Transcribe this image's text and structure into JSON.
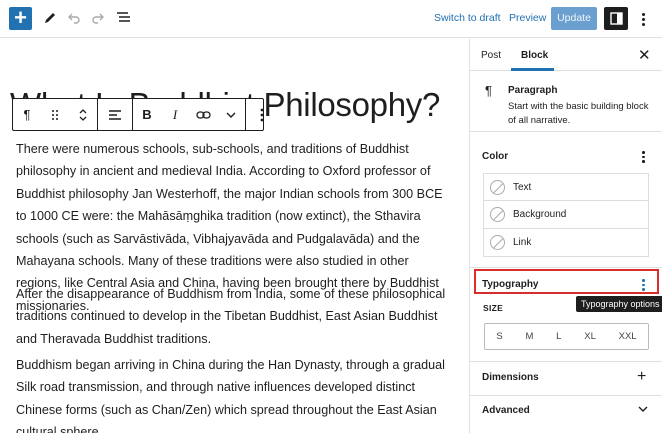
{
  "topbar": {
    "inserter_label": "+",
    "switch_to_draft": "Switch to draft",
    "preview": "Preview",
    "update": "Update"
  },
  "editor": {
    "title": "What Is Buddhist Philosophy?",
    "paragraphs": [
      "There were numerous schools, sub-schools, and traditions of Buddhist philosophy in ancient and medieval India. According to Oxford professor of Buddhist philosophy Jan Westerhoff, the major Indian schools from 300 BCE to 1000 CE were: the Mahāsāṃghika tradition (now extinct), the Sthavira schools (such as Sarvāstivāda, Vibhajyavāda and Pudgalavāda) and the Mahayana schools. Many of these traditions were also studied in other regions, like Central Asia and China, having been brought there by Buddhist missionaries.",
      "After the disappearance of Buddhism from India, some of these philosophical traditions continued to develop in the Tibetan Buddhist, East Asian Buddhist and Theravada Buddhist traditions.",
      "Buddhism began arriving in China during the Han Dynasty, through a gradual Silk road transmission, and through native influences developed distinct Chinese forms (such as Chan/Zen) which spread throughout the East Asian cultural sphere."
    ]
  },
  "block_toolbar": {
    "paragraph_icon": "¶",
    "bold": "B",
    "italic": "I"
  },
  "sidebar": {
    "tabs": [
      "Post",
      "Block"
    ],
    "block_card": {
      "icon": "¶",
      "title": "Paragraph",
      "description": "Start with the basic building block of all narrative."
    },
    "color": {
      "title": "Color",
      "items": [
        "Text",
        "Background",
        "Link"
      ]
    },
    "typography": {
      "title": "Typography",
      "tooltip": "Typography options",
      "size_label": "SIZE",
      "sizes": [
        "S",
        "M",
        "L",
        "XL",
        "XXL"
      ]
    },
    "dimensions": {
      "title": "Dimensions"
    },
    "advanced": {
      "title": "Advanced"
    }
  },
  "colors": {
    "accent": "#2271b1",
    "highlight": "#d92c2c",
    "dark": "#1e1e1e"
  }
}
